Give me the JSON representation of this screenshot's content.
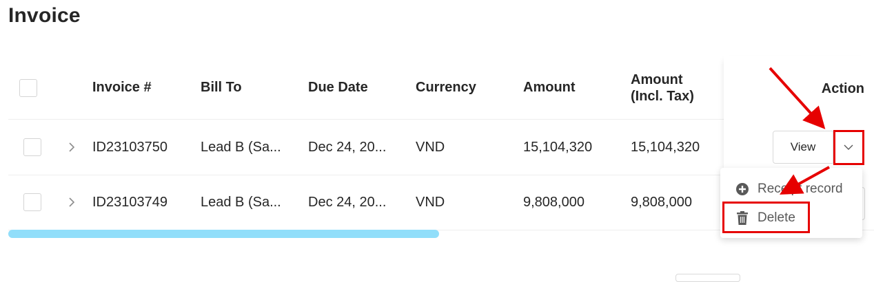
{
  "page": {
    "title": "Invoice"
  },
  "table": {
    "headers": {
      "invoice_no": "Invoice #",
      "bill_to": "Bill To",
      "due_date": "Due Date",
      "currency": "Currency",
      "amount": "Amount",
      "amount_incl_tax_line1": "Amount",
      "amount_incl_tax_line2": "(Incl. Tax)",
      "action": "Action"
    },
    "rows": [
      {
        "invoice_no": "ID23103750",
        "bill_to": "Lead B (Sa...",
        "due_date": "Dec 24, 20...",
        "currency": "VND",
        "amount": "15,104,320",
        "amount_incl_tax": "15,104,320",
        "view_label": "View"
      },
      {
        "invoice_no": "ID23103749",
        "bill_to": "Lead B (Sa...",
        "due_date": "Dec 24, 20...",
        "currency": "VND",
        "amount": "9,808,000",
        "amount_incl_tax": "9,808,000"
      }
    ]
  },
  "dropdown_menu": {
    "items": [
      {
        "label": "Receipt record",
        "icon": "plus-circle-icon"
      },
      {
        "label": "Delete",
        "icon": "trash-icon"
      }
    ]
  },
  "annotation": {
    "color": "#e60000"
  },
  "colors": {
    "scrollbar": "#91defa",
    "text": "#262626",
    "muted": "#8c8c8c"
  }
}
